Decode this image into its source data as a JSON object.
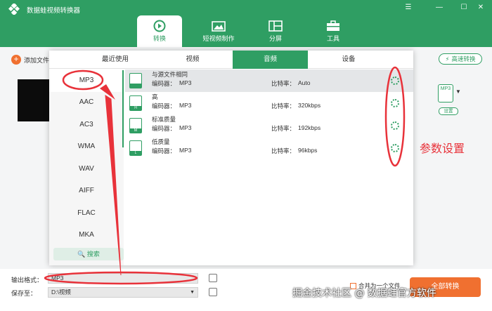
{
  "app": {
    "title": "数据蛙视频转换器",
    "window_controls": [
      "☰",
      "—",
      "☐",
      "✕"
    ]
  },
  "nav": [
    {
      "label": "转换",
      "icon": "convert-icon",
      "active": true
    },
    {
      "label": "短视频制作",
      "icon": "video-maker-icon",
      "active": false
    },
    {
      "label": "分屏",
      "icon": "split-screen-icon",
      "active": false
    },
    {
      "label": "工具",
      "icon": "toolbox-icon",
      "active": false
    }
  ],
  "toolbar": {
    "add_file": "添加文件",
    "turbo": "高速转换"
  },
  "right_panel": {
    "file_label": "MP3",
    "settings": "设置"
  },
  "popup": {
    "tabs": [
      "最近使用",
      "视频",
      "音频",
      "设备"
    ],
    "active_tab": "音频",
    "formats": [
      "MP3",
      "AAC",
      "AC3",
      "WMA",
      "WAV",
      "AIFF",
      "FLAC",
      "MKA"
    ],
    "selected_format": "MP3",
    "search": "搜索",
    "encoder_label": "编码器：",
    "bitrate_label": "比特率：",
    "qualities": [
      {
        "name": "与源文件相同",
        "codec": "MP3",
        "bitrate": "Auto",
        "badge": ""
      },
      {
        "name": "高",
        "codec": "MP3",
        "bitrate": "320kbps",
        "badge": "H"
      },
      {
        "name": "标准质量",
        "codec": "MP3",
        "bitrate": "192kbps",
        "badge": "M"
      },
      {
        "name": "低质量",
        "codec": "MP3",
        "bitrate": "96kbps",
        "badge": "L"
      }
    ]
  },
  "bottom": {
    "output_format_label": "输出格式：",
    "output_format_value": "MP3",
    "save_to_label": "保存至：",
    "save_to_value": "D:\\视频",
    "merge_label": "合并为一个文件",
    "convert_all": "全部转换"
  },
  "annotation": {
    "text": "参数设置",
    "color": "#e8323a"
  },
  "watermark": "掘金技术社区 @ 数据蛙官方软件",
  "colors": {
    "primary": "#2f9e63",
    "accent": "#f07030"
  }
}
